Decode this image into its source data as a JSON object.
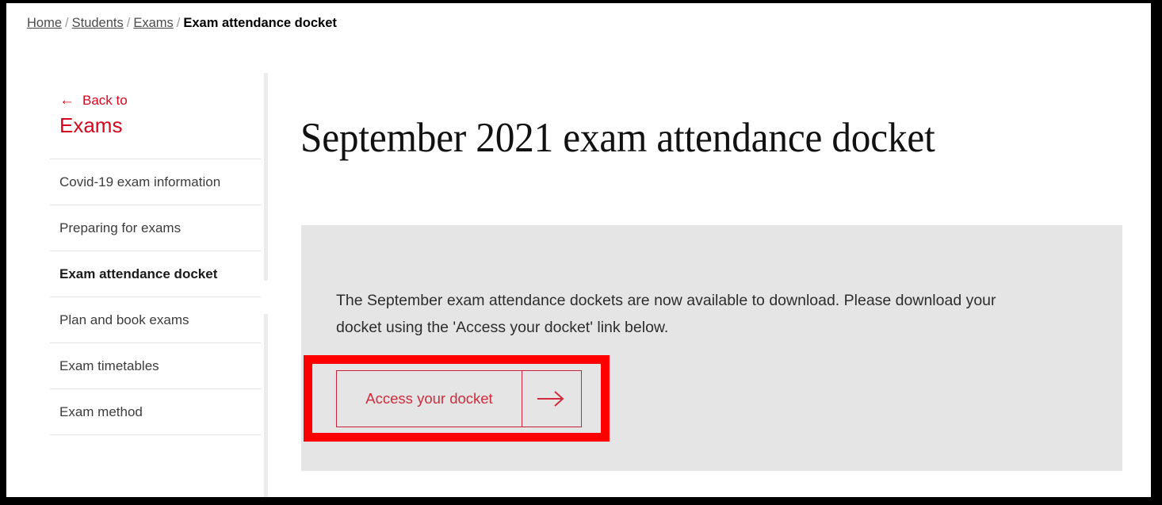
{
  "breadcrumb": {
    "separator": "/",
    "items": [
      {
        "label": "Home",
        "current": false
      },
      {
        "label": "Students",
        "current": false
      },
      {
        "label": "Exams",
        "current": false
      },
      {
        "label": "Exam attendance docket",
        "current": true
      }
    ]
  },
  "sidebar": {
    "back": {
      "arrow_icon": "arrow-left-icon",
      "prefix_label": "Back to",
      "target_label": "Exams"
    },
    "items": [
      {
        "label": "Covid-19 exam information",
        "active": false
      },
      {
        "label": "Preparing for exams",
        "active": false
      },
      {
        "label": "Exam attendance docket",
        "active": true
      },
      {
        "label": "Plan and book exams",
        "active": false
      },
      {
        "label": "Exam timetables",
        "active": false
      },
      {
        "label": "Exam method",
        "active": false
      }
    ]
  },
  "main": {
    "title": "September 2021 exam attendance docket",
    "panel": {
      "body_text": "The September exam attendance dockets are now available to download. Please download your docket using the 'Access your docket' link below.",
      "cta": {
        "label": "Access your docket",
        "arrow_icon": "arrow-right-icon"
      }
    }
  },
  "annotation": {
    "highlight_color": "#ff0000",
    "target": "Access your docket"
  },
  "colors": {
    "brand_red": "#d5071e",
    "cta_red": "#d02b3c",
    "panel_grey": "#e5e5e5",
    "page_white": "#ffffff",
    "frame_black": "#000000"
  }
}
